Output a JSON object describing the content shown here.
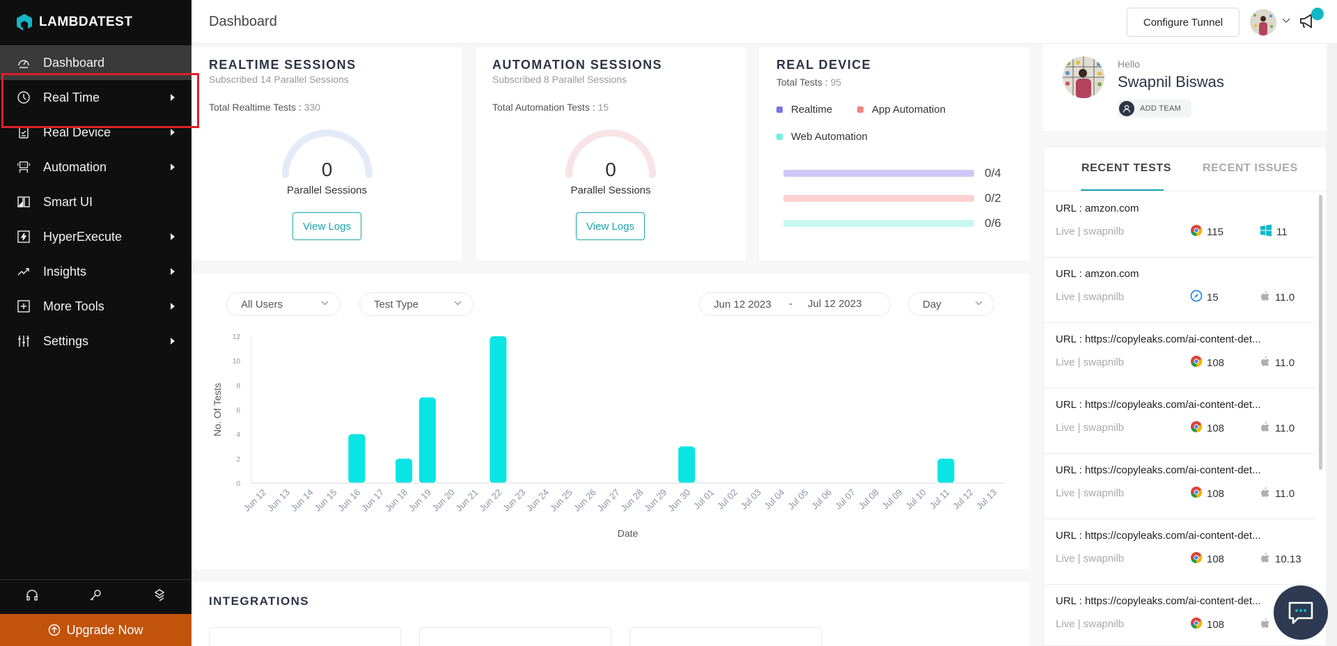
{
  "brand": {
    "name": "LAMBDATEST",
    "accent": "#1aa3ad"
  },
  "sidebar": {
    "items": [
      {
        "label": "Dashboard",
        "icon": "dashboard-icon",
        "has_submenu": false,
        "active": true
      },
      {
        "label": "Real Time",
        "icon": "clock-icon",
        "has_submenu": true,
        "active": false
      },
      {
        "label": "Real Device",
        "icon": "device-icon",
        "has_submenu": true,
        "active": false
      },
      {
        "label": "Automation",
        "icon": "robot-icon",
        "has_submenu": true,
        "active": false
      },
      {
        "label": "Smart UI",
        "icon": "smart-ui-icon",
        "has_submenu": false,
        "active": false
      },
      {
        "label": "HyperExecute",
        "icon": "lightning-icon",
        "has_submenu": true,
        "active": false
      },
      {
        "label": "Insights",
        "icon": "trend-icon",
        "has_submenu": true,
        "active": false
      },
      {
        "label": "More Tools",
        "icon": "plus-box-icon",
        "has_submenu": true,
        "active": false
      },
      {
        "label": "Settings",
        "icon": "sliders-icon",
        "has_submenu": true,
        "active": false
      }
    ],
    "bottom_icons": [
      "headset-icon",
      "key-icon",
      "integration-icon"
    ],
    "upgrade_label": "Upgrade Now",
    "upgrade_color": "#c2530a"
  },
  "header": {
    "title": "Dashboard",
    "configure_tunnel": "Configure Tunnel"
  },
  "realtime": {
    "title": "REALTIME SESSIONS",
    "subtitle": "Subscribed 14 Parallel Sessions",
    "total_label": "Total Realtime Tests :",
    "total_value": "330",
    "gauge_value": "0",
    "gauge_label": "Parallel Sessions",
    "button": "View Logs"
  },
  "automation": {
    "title": "AUTOMATION SESSIONS",
    "subtitle": "Subscribed 8 Parallel Sessions",
    "total_label": "Total Automation Tests :",
    "total_value": "15",
    "gauge_value": "0",
    "gauge_label": "Parallel Sessions",
    "button": "View Logs"
  },
  "real_device": {
    "title": "REAL DEVICE",
    "total_label": "Total Tests :",
    "total_value": "95",
    "legend": [
      {
        "label": "Realtime",
        "color": "#7b73e8"
      },
      {
        "label": "App Automation",
        "color": "#f08585"
      },
      {
        "label": "Web Automation",
        "color": "#6ff0e4"
      }
    ],
    "bars": [
      {
        "used": 0,
        "total": 4,
        "label": "0/4",
        "color": "#cdc8f7"
      },
      {
        "used": 0,
        "total": 2,
        "label": "0/2",
        "color": "#fcd1d1"
      },
      {
        "used": 0,
        "total": 6,
        "label": "0/6",
        "color": "#c8f7f2"
      }
    ]
  },
  "filters": {
    "users": "All Users",
    "test_type": "Test Type",
    "date_from": "Jun 12 2023",
    "date_sep": "-",
    "date_to": "Jul 12 2023",
    "granularity": "Day"
  },
  "chart_data": {
    "type": "bar",
    "title": "",
    "xlabel": "Date",
    "ylabel": "No. Of Tests",
    "ylim": [
      0,
      12
    ],
    "yticks": [
      0,
      2,
      4,
      6,
      8,
      10,
      12
    ],
    "grid": false,
    "bar_color": "#08e5e3",
    "categories": [
      "Jun 12",
      "Jun 13",
      "Jun 14",
      "Jun 15",
      "Jun 16",
      "Jun 17",
      "Jun 18",
      "Jun 19",
      "Jun 20",
      "Jun 21",
      "Jun 22",
      "Jun 23",
      "Jun 24",
      "Jun 25",
      "Jun 26",
      "Jun 27",
      "Jun 28",
      "Jun 29",
      "Jun 30",
      "Jul 01",
      "Jul 02",
      "Jul 03",
      "Jul 04",
      "Jul 05",
      "Jul 06",
      "Jul 07",
      "Jul 08",
      "Jul 09",
      "Jul 10",
      "Jul 11",
      "Jul 12",
      "Jul 13"
    ],
    "values": [
      0,
      0,
      0,
      0,
      4,
      0,
      2,
      7,
      0,
      0,
      12,
      0,
      0,
      0,
      0,
      0,
      0,
      0,
      3,
      0,
      0,
      0,
      0,
      0,
      0,
      0,
      0,
      0,
      0,
      2,
      0,
      0
    ]
  },
  "integrations": {
    "title": "INTEGRATIONS"
  },
  "profile": {
    "greeting": "Hello",
    "name": "Swapnil Biswas",
    "add_team": "ADD TEAM"
  },
  "recent": {
    "tabs": [
      "RECENT TESTS",
      "RECENT ISSUES"
    ],
    "items": [
      {
        "url": "URL : amzon.com",
        "meta": "Live | swapnilb",
        "browser": "chrome",
        "browser_version": "115",
        "os": "windows",
        "os_version": "11"
      },
      {
        "url": "URL : amzon.com",
        "meta": "Live | swapnilb",
        "browser": "safari",
        "browser_version": "15",
        "os": "apple",
        "os_version": "11.0"
      },
      {
        "url": "URL : https://copyleaks.com/ai-content-det...",
        "meta": "Live | swapnilb",
        "browser": "chrome",
        "browser_version": "108",
        "os": "apple",
        "os_version": "11.0"
      },
      {
        "url": "URL : https://copyleaks.com/ai-content-det...",
        "meta": "Live | swapnilb",
        "browser": "chrome",
        "browser_version": "108",
        "os": "apple",
        "os_version": "11.0"
      },
      {
        "url": "URL : https://copyleaks.com/ai-content-det...",
        "meta": "Live | swapnilb",
        "browser": "chrome",
        "browser_version": "108",
        "os": "apple",
        "os_version": "11.0"
      },
      {
        "url": "URL : https://copyleaks.com/ai-content-det...",
        "meta": "Live | swapnilb",
        "browser": "chrome",
        "browser_version": "108",
        "os": "apple",
        "os_version": "10.13"
      },
      {
        "url": "URL : https://copyleaks.com/ai-content-det...",
        "meta": "Live | swapnilb",
        "browser": "chrome",
        "browser_version": "108",
        "os": "apple",
        "os_version": ""
      }
    ]
  }
}
